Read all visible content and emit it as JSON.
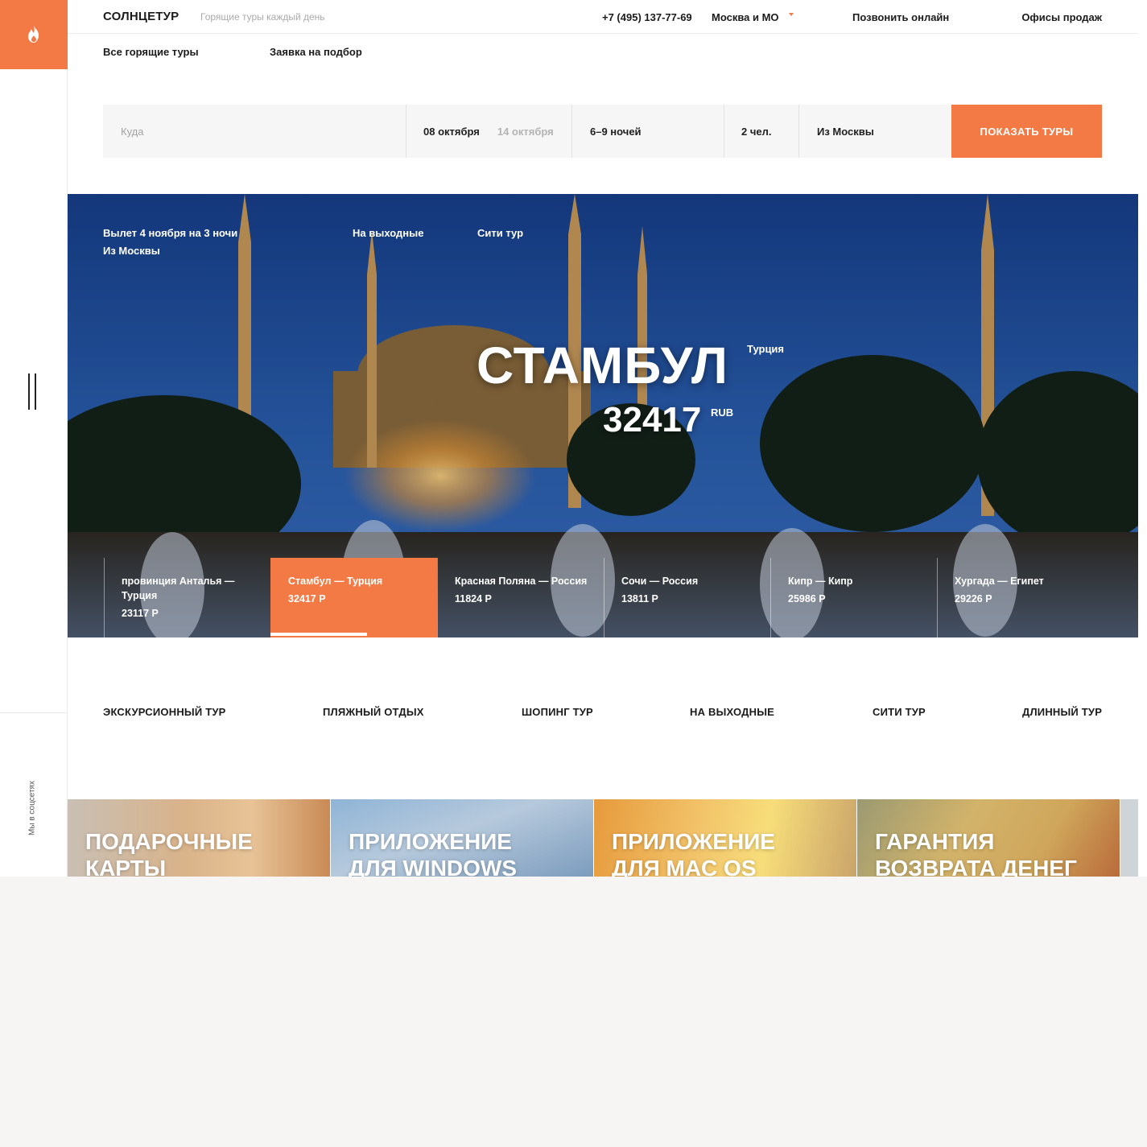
{
  "brand": {
    "name": "СОЛНЦЕТУР",
    "tagline": "Горящие туры каждый день"
  },
  "header": {
    "phone": "+7 (495) 137-77-69",
    "region": "Москва и МО",
    "call_online": "Позвонить онлайн",
    "offices": "Офисы продаж"
  },
  "nav": [
    "Все горящие туры",
    "Заявка на подбор"
  ],
  "search": {
    "destination_placeholder": "Куда",
    "date_from": "08 октября",
    "date_to": "14 октября",
    "nights": "6–9 ночей",
    "people": "2 чел.",
    "departure": "Из Москвы",
    "button": "ПОКАЗАТЬ ТУРЫ"
  },
  "hero": {
    "tag_line1": "Вылет 4 ноября на 3 ночи",
    "tag_line2": "Из Москвы",
    "tag_weekend": "На выходные",
    "tag_city": "Сити тур",
    "city": "СТАМБУЛ",
    "country": "Турция",
    "price": "32417",
    "currency": "RUB",
    "slides": [
      {
        "title": "провинция Анталья — Турция",
        "price": "23117 Р",
        "active": false
      },
      {
        "title": "Стамбул — Турция",
        "price": "32417 Р",
        "active": true
      },
      {
        "title": "Красная Поляна — Россия",
        "price": "11824 Р",
        "active": false
      },
      {
        "title": "Сочи — Россия",
        "price": "13811 Р",
        "active": false
      },
      {
        "title": "Кипр — Кипр",
        "price": "25986 Р",
        "active": false
      },
      {
        "title": "Хургада — Египет",
        "price": "29226 Р",
        "active": false
      }
    ]
  },
  "categories": [
    "ЭКСКУРСИОННЫЙ ТУР",
    "ПЛЯЖНЫЙ ОТДЫХ",
    "ШОПИНГ ТУР",
    "НА ВЫХОДНЫЕ",
    "СИТИ ТУР",
    "ДЛИННЫЙ ТУР"
  ],
  "tiles": [
    {
      "line1": "ПОДАРОЧНЫЕ",
      "line2": "КАРТЫ"
    },
    {
      "line1": "ПРИЛОЖЕНИЕ",
      "line2": "ДЛЯ WINDOWS"
    },
    {
      "line1": "ПРИЛОЖЕНИЕ",
      "line2": "ДЛЯ MAC OS"
    },
    {
      "line1": "ГАРАНТИЯ",
      "line2": "ВОЗВРАТА ДЕНЕГ"
    }
  ],
  "social_label": "Мы в соцсетях",
  "colors": {
    "accent": "#f47a45",
    "sky": "#1f4ea0"
  },
  "icons": {
    "logo": "flame-icon",
    "menu": "menu-icon",
    "region_caret": "caret-down-icon"
  }
}
